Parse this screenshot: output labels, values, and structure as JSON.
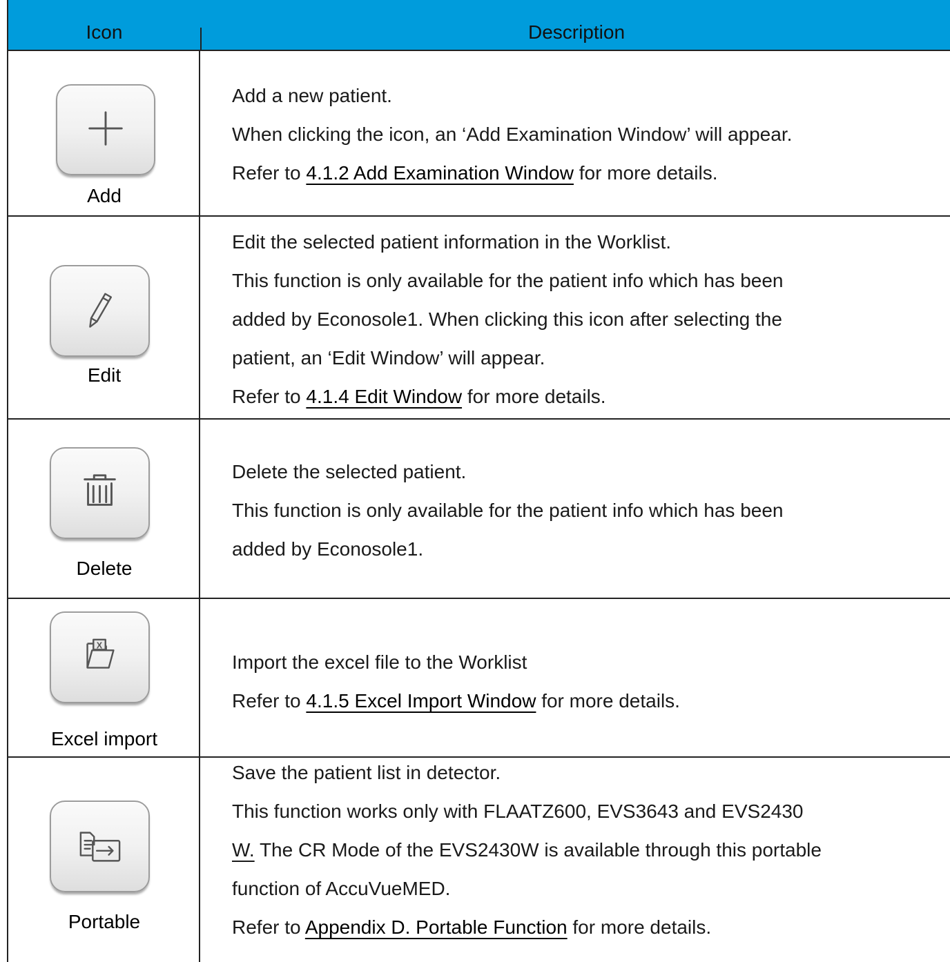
{
  "header": {
    "icon_col": "Icon",
    "desc_col": "Description"
  },
  "rows": [
    {
      "icon": "plus-icon",
      "label": "Add",
      "lines": [
        {
          "text": "Add a new patient."
        },
        {
          "text": "When clicking the icon, an ‘Add Examination Window’ will appear."
        },
        {
          "pre": "Refer to ",
          "link": "4.1.2 Add Examination Window",
          "post": " for more details."
        }
      ]
    },
    {
      "icon": "pencil-icon",
      "label": "Edit",
      "lines": [
        {
          "text": "Edit the selected patient information in the Worklist."
        },
        {
          "text": "This function is only available for the patient info which has been"
        },
        {
          "text": "added by Econosole1. When clicking this icon after selecting the"
        },
        {
          "text": "patient, an ‘Edit Window’ will appear."
        },
        {
          "pre": "Refer to ",
          "link": "4.1.4 Edit Window",
          "post": " for more details."
        }
      ]
    },
    {
      "icon": "trash-icon",
      "label": "Delete",
      "lines": [
        {
          "text": "Delete the selected patient."
        },
        {
          "text": "This function is only available for the patient info which has been"
        },
        {
          "text": "added by Econosole1."
        }
      ]
    },
    {
      "icon": "excel-folder-icon",
      "label": "Excel import",
      "lines": [
        {
          "text": "Import the excel file to the Worklist"
        },
        {
          "pre": "Refer to ",
          "link": "4.1.5 Excel Import Window",
          "post": " for more details."
        }
      ]
    },
    {
      "icon": "portable-transfer-icon",
      "label": "Portable",
      "lines": [
        {
          "text": "Save the patient list in detector."
        },
        {
          "text": "This function works only with FLAATZ600, EVS3643 and EVS2430"
        },
        {
          "underlined": "W.",
          "post": " The CR Mode of the EVS2430W is available through this portable"
        },
        {
          "text": "function of AccuVueMED."
        },
        {
          "pre": "Refer to ",
          "link": "Appendix D. Portable Function",
          "post": " for more details."
        }
      ]
    }
  ]
}
